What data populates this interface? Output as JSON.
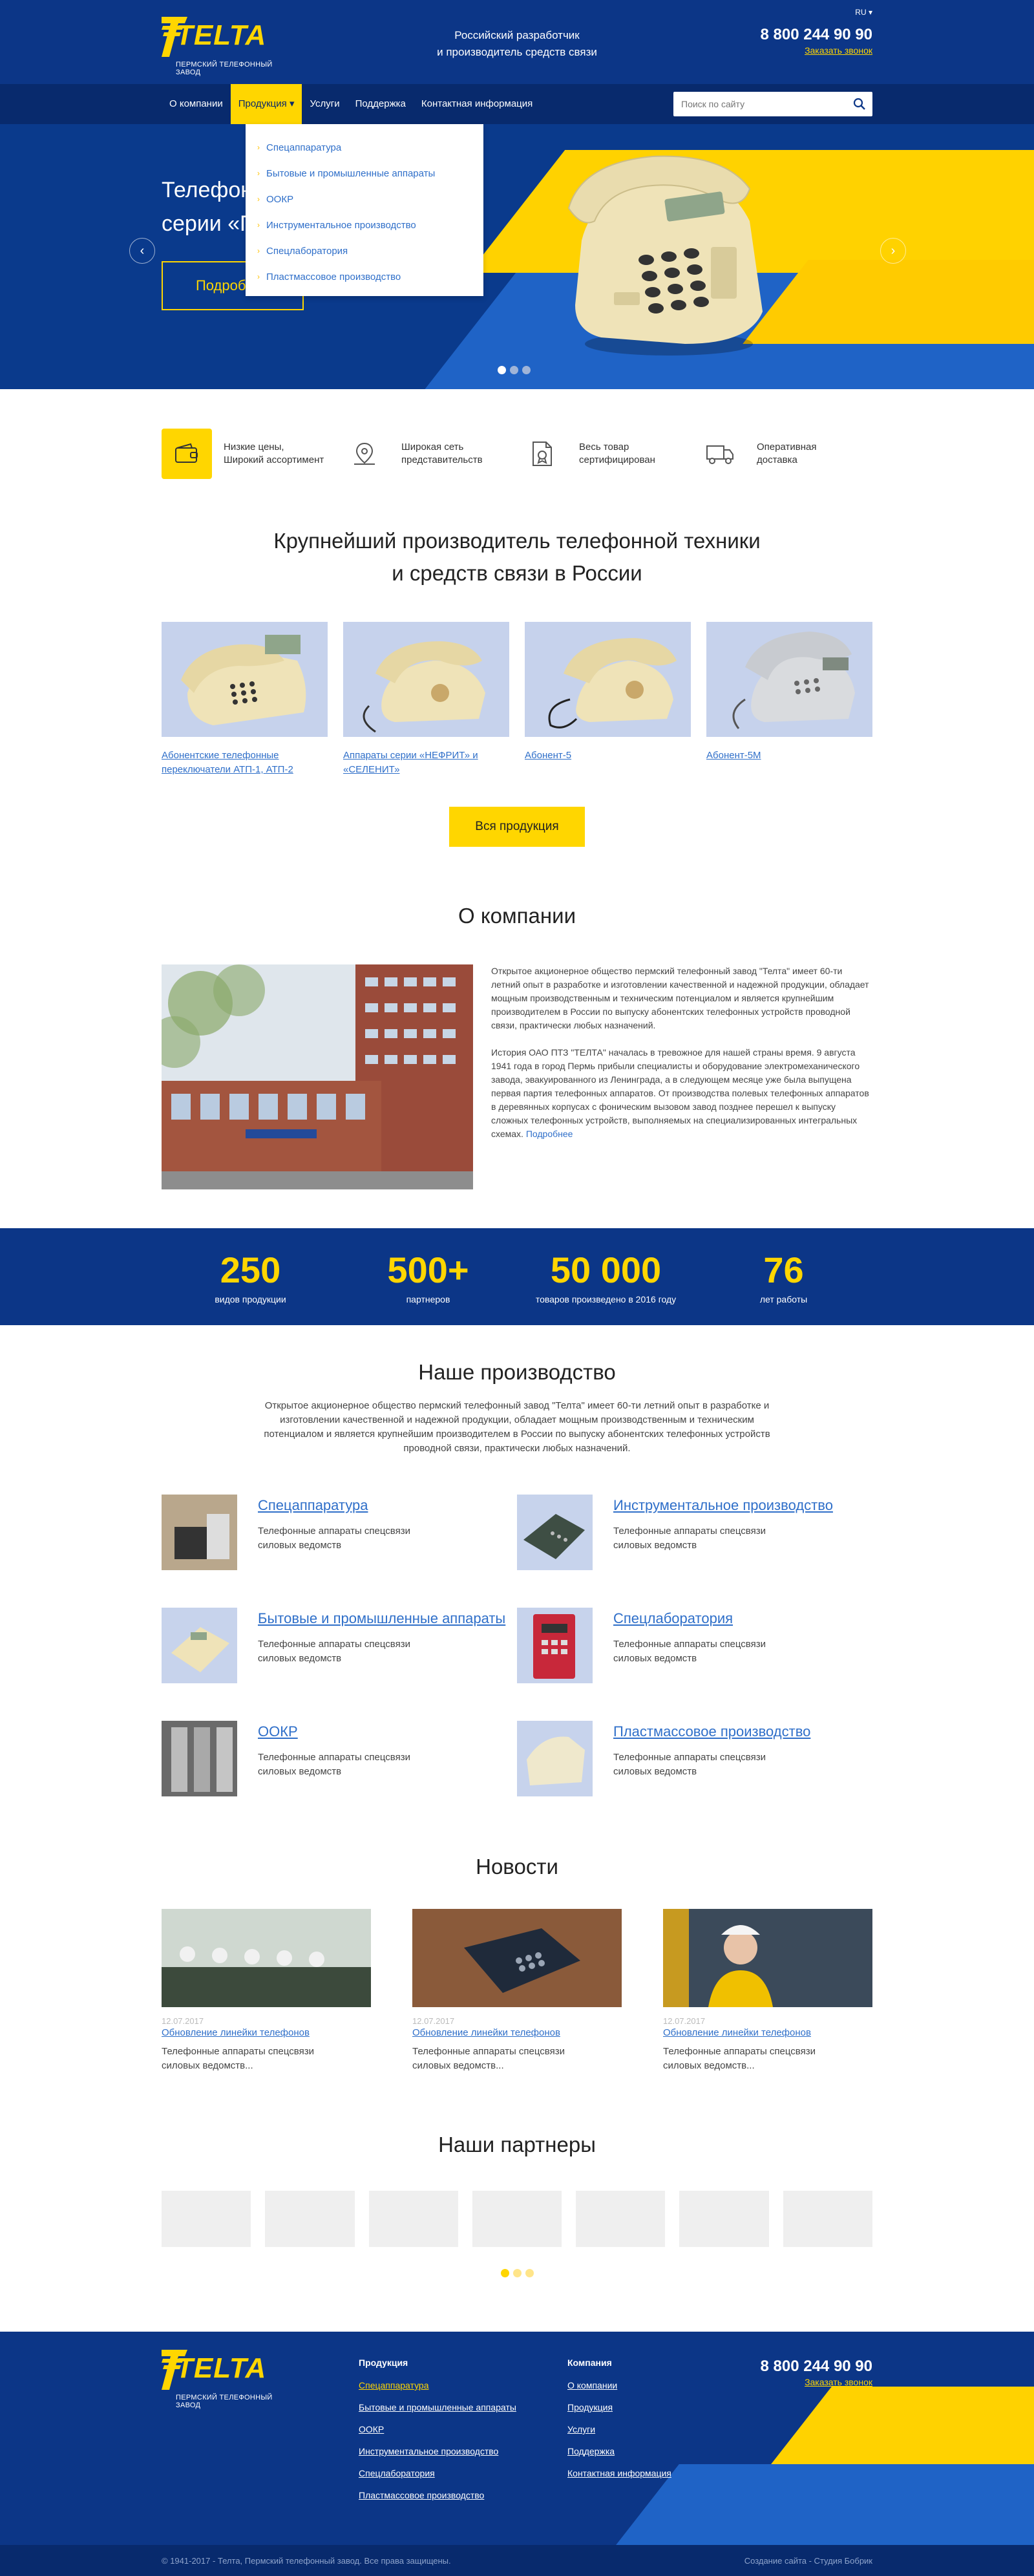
{
  "header": {
    "logo_text": "TELTA",
    "logo_sub": "ПЕРМСКИЙ ТЕЛЕФОННЫЙ ЗАВОД",
    "tagline_1": "Российский разработчик",
    "tagline_2": "и производитель средств связи",
    "lang": "RU ▾",
    "phone": "8 800 244 90 90",
    "callback": "Заказать звонок"
  },
  "nav": {
    "items": [
      {
        "label": "О компании"
      },
      {
        "label": "Продукция ▾"
      },
      {
        "label": "Услуги"
      },
      {
        "label": "Поддержка"
      },
      {
        "label": "Контактная информация"
      }
    ],
    "search_placeholder": "Поиск по сайту",
    "dropdown": [
      {
        "label": "Спецаппаратура"
      },
      {
        "label": "Бытовые и промышленные аппараты"
      },
      {
        "label": "ООКР"
      },
      {
        "label": "Инструментальное производство"
      },
      {
        "label": "Спецлаборатория"
      },
      {
        "label": "Пластмассовое производство"
      }
    ]
  },
  "hero": {
    "title_1": "Телефонные аппараты",
    "title_2": "серии «П",
    "button": "Подробнее",
    "prev": "‹",
    "next": "›"
  },
  "features": [
    {
      "text": "Низкие цены,\nШирокий ассортимент",
      "icon": "wallet-icon"
    },
    {
      "text": "Широкая сеть\nпредставительств",
      "icon": "map-pin-icon"
    },
    {
      "text": "Весь товар\nсертифицирован",
      "icon": "certificate-icon"
    },
    {
      "text": "Оперативная\nдоставка",
      "icon": "truck-icon"
    }
  ],
  "lead": {
    "line1": "Крупнейший производитель телефонной техники",
    "line2": "и средств связи в России"
  },
  "products": [
    {
      "label": "Абонентские телефонные переключатели АТП-1, АТП-2"
    },
    {
      "label": "Аппараты серии «НЕФРИТ» и «СЕЛЕНИТ»"
    },
    {
      "label": "Абонент-5"
    },
    {
      "label": "Абонент-5М"
    }
  ],
  "all_products": "Вся продукция",
  "about": {
    "title": "О компании",
    "p1": "Открытое акционерное общество пермский телефонный завод \"Телта\" имеет 60-ти летний опыт в разработке и изготовлении качественной и надежной продукции, обладает мощным производственным и техническим потенциалом и является крупнейшим производителем в России по выпуску абонентских телефонных устройств проводной связи, практически любых назначений.",
    "p2": "История ОАО ПТЗ \"ТЕЛТА\" началась в тревожное для нашей страны время. 9 августа 1941 года в город Пермь прибыли специалисты и оборудование электромеханического завода, эвакуированного из Ленинграда, а в следующем месяце уже была выпущена первая партия телефонных аппаратов. От производства полевых телефонных аппаратов в деревянных корпусах с фоническим вызовом завод позднее перешел к выпуску сложных телефонных устройств, выполняемых на специализированных интегральных схемах.",
    "more": "Подробнее"
  },
  "stats": [
    {
      "value": "250",
      "label": "видов продукции"
    },
    {
      "value": "500+",
      "label": "партнеров"
    },
    {
      "value": "50 000",
      "label": "товаров произведено в 2016 году"
    },
    {
      "value": "76",
      "label": "лет работы"
    }
  ],
  "production": {
    "title": "Наше производство",
    "lead": "Открытое акционерное общество пермский телефонный завод \"Телта\" имеет 60-ти летний опыт в разработке и изготовлении качественной и надежной продукции, обладает мощным производственным и техническим потенциалом и является крупнейшим производителем в России по выпуску абонентских телефонных устройств проводной связи, практически любых назначений.",
    "items": [
      {
        "title": "Спецаппаратура",
        "desc": "Телефонные аппараты спецсвязи\nсиловых ведомств"
      },
      {
        "title": "Инструментальное производство",
        "desc": "Телефонные аппараты спецсвязи\nсиловых ведомств"
      },
      {
        "title": "Бытовые и промышленные аппараты",
        "desc": "Телефонные аппараты спецсвязи\nсиловых ведомств"
      },
      {
        "title": "Спецлаборатория",
        "desc": "Телефонные аппараты спецсвязи\nсиловых ведомств"
      },
      {
        "title": "ООКР",
        "desc": "Телефонные аппараты спецсвязи\nсиловых ведомств"
      },
      {
        "title": "Пластмассовое производство",
        "desc": "Телефонные аппараты спецсвязи\nсиловых ведомств"
      }
    ]
  },
  "news": {
    "title": "Новости",
    "items": [
      {
        "date": "12.07.2017",
        "link": "Обновление линейки телефонов",
        "text": "Телефонные аппараты спецсвязи\nсиловых ведомств..."
      },
      {
        "date": "12.07.2017",
        "link": "Обновление линейки телефонов",
        "text": "Телефонные аппараты спецсвязи\nсиловых ведомств..."
      },
      {
        "date": "12.07.2017",
        "link": "Обновление линейки телефонов",
        "text": "Телефонные аппараты спецсвязи\nсиловых ведомств..."
      }
    ]
  },
  "partners": {
    "title": "Наши партнеры"
  },
  "footer": {
    "col1_title": "Продукция",
    "col1": [
      {
        "label": "Спецаппаратура"
      },
      {
        "label": "Бытовые и промышленные аппараты"
      },
      {
        "label": "ООКР"
      },
      {
        "label": "Инструментальное производство"
      },
      {
        "label": "Спецлаборатория"
      },
      {
        "label": "Пластмассовое производство"
      }
    ],
    "col2_title": "Компания",
    "col2": [
      {
        "label": "О компании"
      },
      {
        "label": "Продукция"
      },
      {
        "label": "Услуги"
      },
      {
        "label": "Поддержка"
      },
      {
        "label": "Контактная информация"
      }
    ],
    "phone": "8 800 244 90 90",
    "callback": "Заказать звонок",
    "copyright": "© 1941-2017 - Телта, Пермский телефонный завод. Все права защищены.",
    "credit_link": "Создание сайта",
    "credit_rest": " - Студия Бобрик"
  },
  "colors": {
    "brand_blue": "#0c3687",
    "accent_yellow": "#ffd600",
    "link_blue": "#2f6fc9"
  }
}
